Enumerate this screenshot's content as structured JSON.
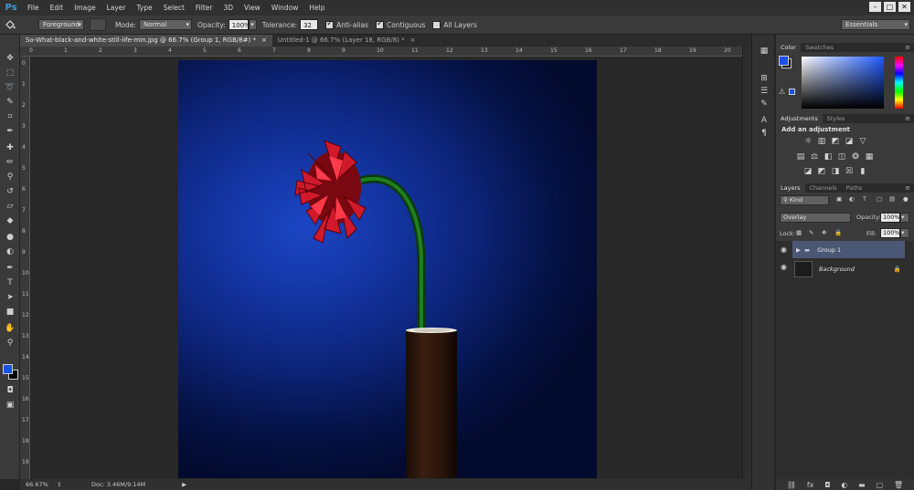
{
  "app": {
    "logo": "Ps"
  },
  "menu": [
    "File",
    "Edit",
    "Image",
    "Layer",
    "Type",
    "Select",
    "Filter",
    "3D",
    "View",
    "Window",
    "Help"
  ],
  "window_controls": [
    "–",
    "□",
    "✕"
  ],
  "options": {
    "tool_icon": "paint-bucket-icon",
    "source": "Foreground",
    "mode_label": "Mode:",
    "mode": "Normal",
    "opacity_label": "Opacity:",
    "opacity": "100%",
    "tolerance_label": "Tolerance:",
    "tolerance": "32",
    "anti_alias": "Anti-alias",
    "contiguous": "Contiguous",
    "all_layers": "All Layers",
    "workspace": "Essentials"
  },
  "tabs": [
    {
      "label": "So-What-black-and-white-still-life-min.jpg @ 66.7% (Group 1, RGB/8#) *",
      "close": "×"
    },
    {
      "label": "Untitled-1 @ 66.7% (Layer 18, RGB/8) *",
      "close": "×"
    }
  ],
  "ruler": {
    "top": [
      "0",
      "1",
      "2",
      "3",
      "4",
      "5",
      "6",
      "7",
      "8",
      "9",
      "10",
      "11",
      "12",
      "13",
      "14",
      "15",
      "16",
      "17",
      "18",
      "19",
      "20"
    ],
    "left": [
      "0",
      "1",
      "2",
      "3",
      "4",
      "5",
      "6",
      "7",
      "8",
      "9",
      "10",
      "11",
      "12",
      "13",
      "14",
      "15",
      "16",
      "17",
      "18",
      "19"
    ]
  },
  "status": {
    "zoom": "66.67%",
    "doc": "Doc: 3.46M/9.14M"
  },
  "colors": {
    "foreground": "#1a52e6",
    "background": "#000000",
    "accent": "#3c9bd6"
  },
  "color_panel": {
    "tabs": [
      "Color",
      "Swatches"
    ]
  },
  "adjustments_panel": {
    "tabs": [
      "Adjustments",
      "Styles"
    ],
    "heading": "Add an adjustment"
  },
  "layers_panel": {
    "tabs": [
      "Layers",
      "Channels",
      "Paths"
    ],
    "kind": "Kind",
    "blend_mode": "Overlay",
    "opacity_label": "Opacity:",
    "opacity": "100%",
    "lock_label": "Lock:",
    "fill_label": "Fill:",
    "fill": "100%",
    "layers": [
      {
        "name": "Group 1",
        "type": "group",
        "selected": true
      },
      {
        "name": "Background",
        "type": "image",
        "locked": true
      }
    ]
  }
}
